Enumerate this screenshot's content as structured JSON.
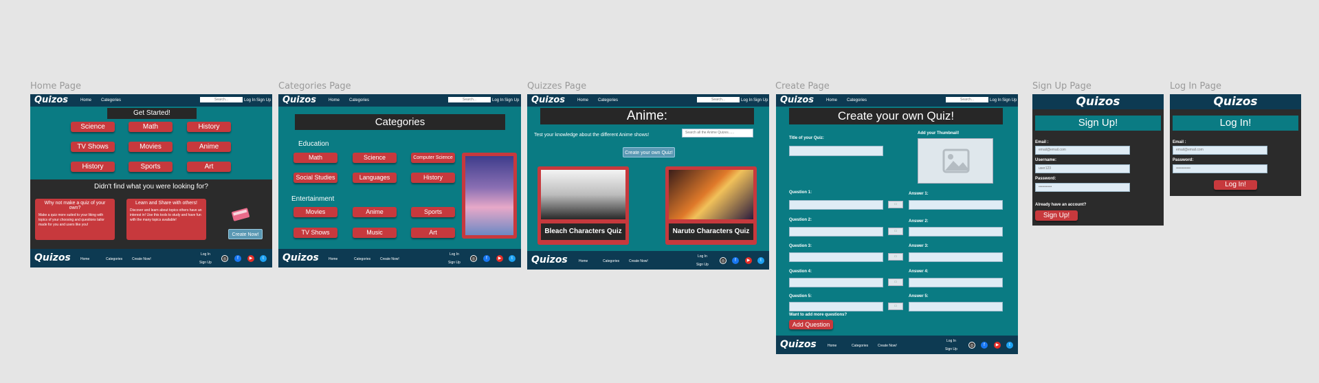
{
  "brand": "Quizos",
  "nav": {
    "home": "Home",
    "categories": "Categories",
    "search": "Search...",
    "login": "Log In",
    "signup": "Sign Up"
  },
  "footer": {
    "home": "Home",
    "categories": "Categories",
    "create": "Create Now!",
    "login": "Log In",
    "signup": "Sign Up"
  },
  "frames": {
    "home": {
      "label": "Home Page"
    },
    "categories": {
      "label": "Categories Page"
    },
    "quizzes": {
      "label": "Quizzes Page"
    },
    "create": {
      "label": "Create Page"
    },
    "signup": {
      "label": "Sign Up Page"
    },
    "login": {
      "label": "Log In Page"
    }
  },
  "home": {
    "get_started": "Get Started!",
    "categories": [
      "Science",
      "Math",
      "History",
      "TV Shows",
      "Movies",
      "Anime",
      "History",
      "Sports",
      "Art"
    ],
    "didnt_find": "Didn't find what you were looking for?",
    "card1_title": "Why not make a quiz of your own?",
    "card1_text": "Make a quiz more suited to your liking with topics of your choosing and questions tailor made for you and users like you!",
    "card2_title": "Learn and Share with others!",
    "card2_text": "Discover and learn about topics others have an interest in! Use this tools to study and have fun with the many topics available!",
    "create_now": "Create Now!"
  },
  "categories_page": {
    "title": "Categories",
    "education": "Education",
    "education_items": [
      "Math",
      "Science",
      "Computer Science",
      "Social Studies",
      "Languages",
      "History"
    ],
    "entertainment": "Entertainment",
    "entertainment_items": [
      "Movies",
      "Anime",
      "Sports",
      "TV Shows",
      "Music",
      "Art"
    ]
  },
  "quizzes": {
    "title": "Anime:",
    "subtitle": "Test your knowledge about the different Anime shows!",
    "search": "Search all the Anime Quizes......",
    "create_button": "Create your own Quiz!",
    "quiz1": "Bleach Characters Quiz",
    "quiz2": "Naruto Characters Quiz"
  },
  "create": {
    "title": "Create your own Quiz!",
    "title_label": "Title of your Quiz:",
    "thumb_label": "Add your Thumbnail!",
    "questions": [
      "Question 1:",
      "Question 2:",
      "Question 3:",
      "Question 4:",
      "Question 5:"
    ],
    "answers": [
      "Answer 1:",
      "Answer 2:",
      "Answer 3:",
      "Answer 4:",
      "Answer 5:"
    ],
    "more": "Want to add more questions?",
    "add_button": "Add Question"
  },
  "signup": {
    "title": "Sign Up!",
    "email_label": "Email :",
    "email_placeholder": "email@email.com",
    "username_label": "Username:",
    "username_placeholder": "user123",
    "password_label": "Password:",
    "password_value": "•••••••••••",
    "already": "Already have an account?",
    "button": "Sign Up!"
  },
  "login": {
    "title": "Log In!",
    "email_label": "Email :",
    "email_placeholder": "email@email.com",
    "password_label": "Password:",
    "password_value": "••••••••••••",
    "button": "Log In!"
  },
  "colors": {
    "teal": "#0a7b83",
    "navy": "#0d3a52",
    "red": "#c7393d",
    "dark": "#272727"
  },
  "icons": [
    "instagram-icon",
    "facebook-icon",
    "youtube-icon",
    "twitter-icon",
    "image-placeholder-icon",
    "book-icon",
    "picture-icon"
  ]
}
